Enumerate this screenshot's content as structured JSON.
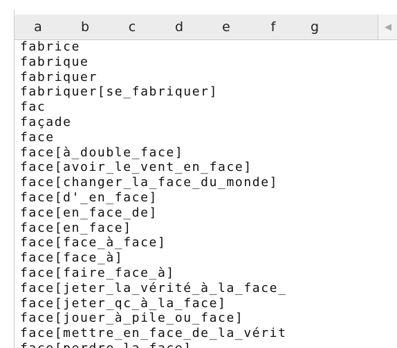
{
  "tabs": [
    "a",
    "b",
    "c",
    "d",
    "e",
    "f",
    "g"
  ],
  "scroll_icon": "triangle-left-icon",
  "entries": [
    "fabrice",
    "fabrique",
    "fabriquer",
    "fabriquer[se_fabriquer]",
    "fac",
    "façade",
    "face",
    "face[à_double_face]",
    "face[avoir_le_vent_en_face]",
    "face[changer_la_face_du_monde]",
    "face[d'_en_face]",
    "face[en_face_de]",
    "face[en_face]",
    "face[face_à_face]",
    "face[face_à]",
    "face[faire_face_à]",
    "face[jeter_la_vérité_à_la_face_",
    "face[jeter_qc_à_la_face]",
    "face[jouer_à_pile_ou_face]",
    "face[mettre_en_face_de_la_vérit",
    "face[perdre_la_face]"
  ]
}
